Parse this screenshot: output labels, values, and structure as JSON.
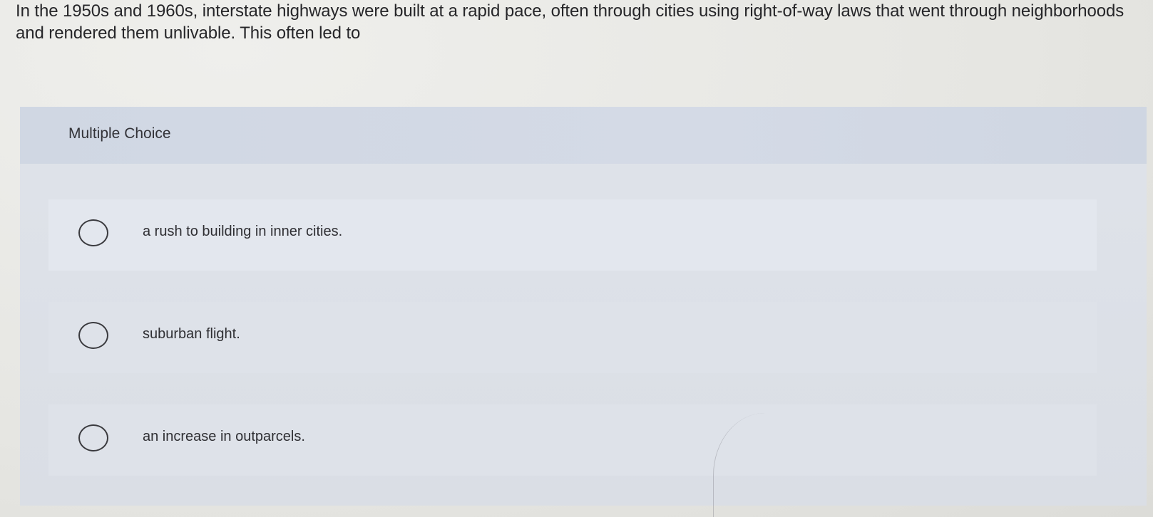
{
  "question": {
    "text": "In the 1950s and 1960s, interstate highways were built at a rapid pace, often through cities using right-of-way laws that went through neighborhoods and rendered them unlivable. This often led to"
  },
  "multiple_choice": {
    "header_label": "Multiple Choice",
    "options": [
      {
        "label": "a rush to building in inner cities.",
        "selected": false
      },
      {
        "label": "suburban flight.",
        "selected": false
      },
      {
        "label": "an increase in outparcels.",
        "selected": false
      }
    ]
  },
  "colors": {
    "background": "#e9e8e4",
    "card": "#dadee5",
    "header": "#d2d9e5",
    "text": "#2a2a2d"
  },
  "icons": {
    "radio": "radio-unchecked-icon"
  }
}
